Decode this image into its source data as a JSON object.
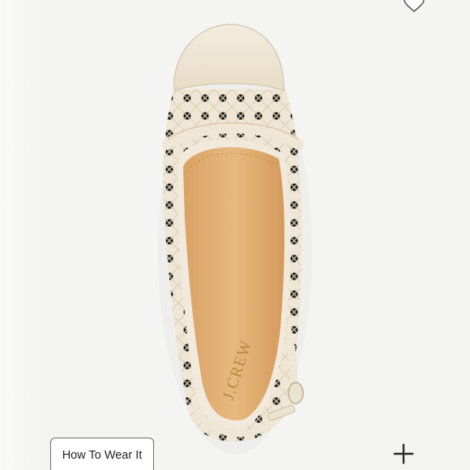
{
  "product_image": {
    "icon": "woven-slingback-flat",
    "brand_mark": "J.CREW",
    "accent_colors": {
      "upper": "#efe6d6",
      "insole": "#e2b27a",
      "stitch": "#d9c9ad"
    }
  },
  "actions": {
    "favorite_icon": "heart-outline-icon",
    "how_to_wear_label": "How To Wear It",
    "zoom_icon": "plus-icon"
  }
}
